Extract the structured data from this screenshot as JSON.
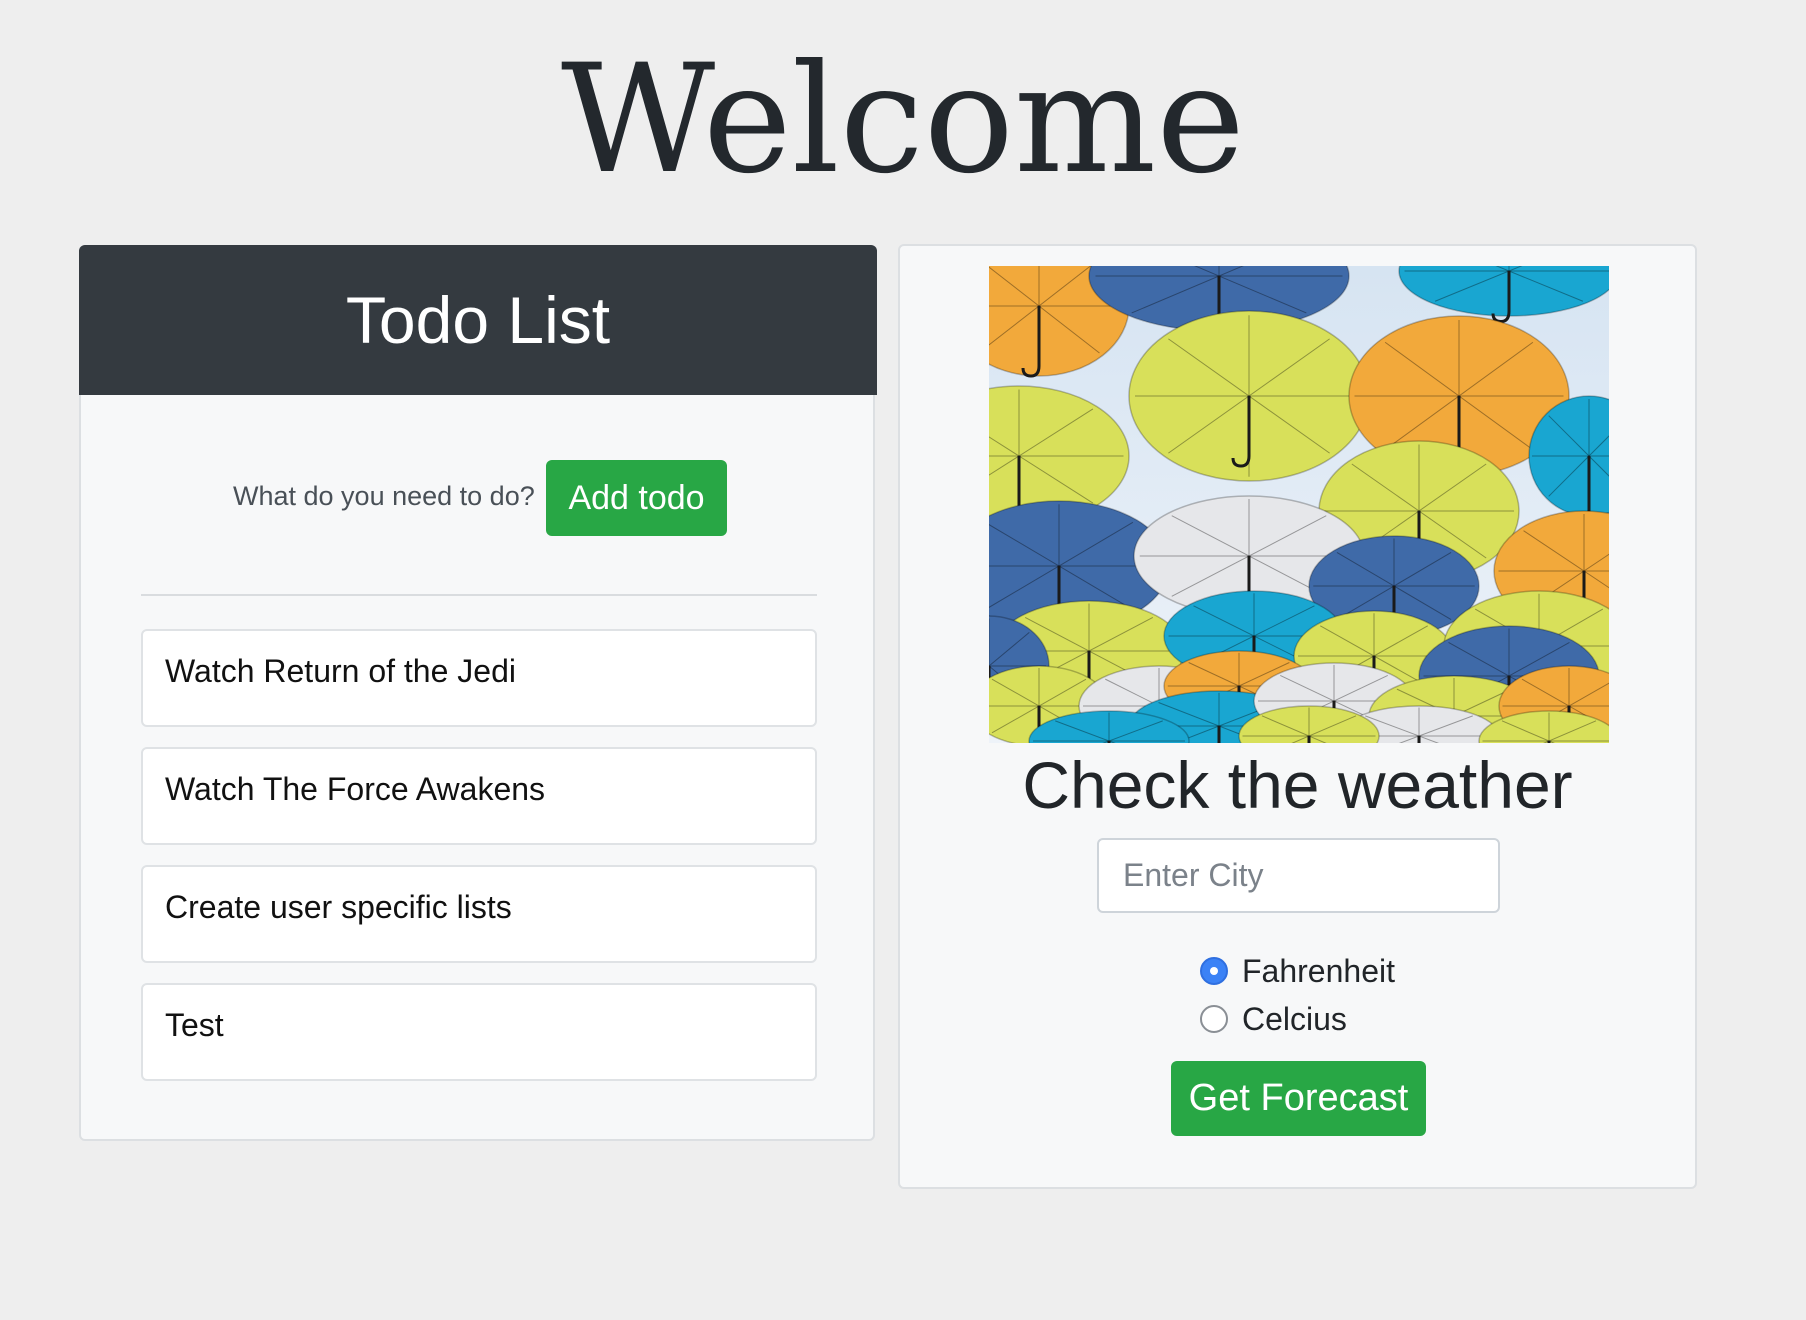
{
  "page": {
    "title": "Welcome"
  },
  "todo": {
    "header": "Todo List",
    "prompt": "What do you need to do?",
    "add_button": "Add todo",
    "items": [
      "Watch Return of the Jedi",
      "Watch The Force Awakens",
      "Create user specific lists",
      "Test"
    ]
  },
  "weather": {
    "image_alt": "colorful-umbrellas-image",
    "title": "Check the weather",
    "city_placeholder": "Enter City",
    "city_value": "",
    "units": [
      {
        "label": "Fahrenheit",
        "checked": true
      },
      {
        "label": "Celcius",
        "checked": false
      }
    ],
    "forecast_button": "Get Forecast"
  },
  "colors": {
    "background": "#eeeeee",
    "header_dark": "#343a40",
    "success_green": "#28a745",
    "radio_blue": "#3b82f6",
    "umbrella_yellow": "#d8e05a",
    "umbrella_orange": "#f2a93b",
    "umbrella_blue": "#3f6aa8",
    "umbrella_cyan": "#19a6d1",
    "umbrella_white": "#e6e7ea"
  }
}
